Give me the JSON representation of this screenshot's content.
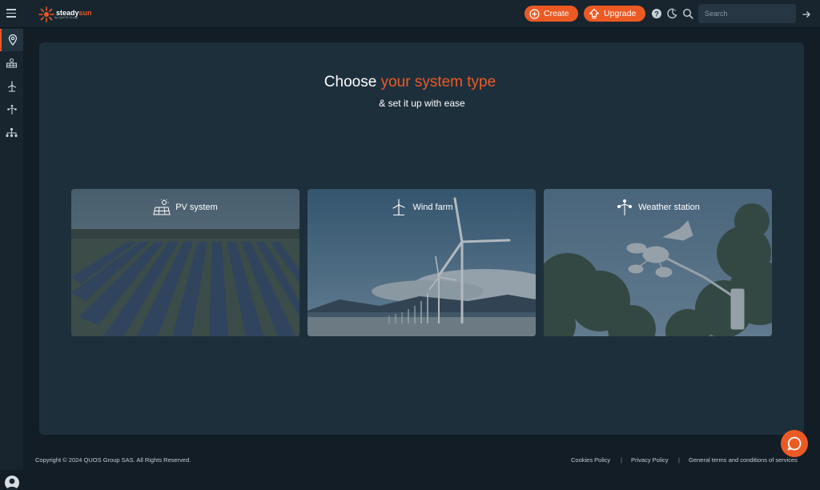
{
  "brand": {
    "name_part1": "steady",
    "name_part2": "sun",
    "tagline": "by QUOS Group"
  },
  "topbar": {
    "create_label": "Create",
    "upgrade_label": "Upgrade",
    "search_placeholder": "Search"
  },
  "main": {
    "title_part1": "Choose ",
    "title_accent": "your system type",
    "subtitle": "& set it up with ease",
    "cards": [
      {
        "label": "PV system"
      },
      {
        "label": "Wind farm"
      },
      {
        "label": "Weather station"
      }
    ]
  },
  "footer": {
    "copyright": "Copyright © 2024 QUOS Group SAS. All Rights Reserved.",
    "links": [
      "Cookies Policy",
      "Privacy Policy",
      "General terms and conditions of services"
    ],
    "separator": "|"
  },
  "colors": {
    "accent": "#ec5a24",
    "panel": "#1e2f3c",
    "background": "#121d26"
  }
}
